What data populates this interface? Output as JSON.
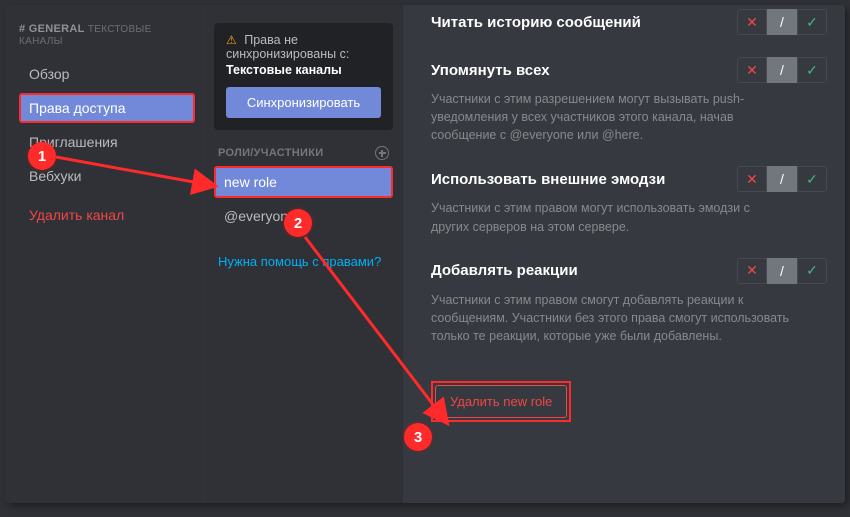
{
  "sidebar": {
    "channel_prefix": "# GENERAL",
    "channel_type": "ТЕКСТОВЫЕ КАНАЛЫ",
    "items": [
      "Обзор",
      "Права доступа",
      "Приглашения",
      "Вебхуки"
    ],
    "selected_index": 1,
    "delete": "Удалить канал"
  },
  "mid": {
    "sync_line1": "Права не синхронизированы с:",
    "sync_bold": "Текстовые каналы",
    "sync_btn": "Синхронизировать",
    "roles_header": "РОЛИ/УЧАСТНИКИ",
    "roles": [
      "new role",
      "@everyone"
    ],
    "selected_role_index": 0,
    "help": "Нужна помощь с правами?"
  },
  "perms": [
    {
      "title": "Читать историю сообщений",
      "desc": ""
    },
    {
      "title": "Упомянуть всех",
      "desc": "Участники с этим разрешением могут вызывать push-уведомления у всех участников этого канала, начав сообщение с @everyone или @here."
    },
    {
      "title": "Использовать внешние эмодзи",
      "desc": "Участники с этим правом могут использовать эмодзи с других серверов на этом сервере."
    },
    {
      "title": "Добавлять реакции",
      "desc": "Участники с этим правом смогут добавлять реакции к сообщениям. Участники без этого права смогут использовать только те реакции, которые уже были добавлены."
    }
  ],
  "delete_role_btn": "Удалить new role",
  "toggle": {
    "x": "✕",
    "slash": "/",
    "check": "✓"
  },
  "callouts": {
    "c1": "1",
    "c2": "2",
    "c3": "3"
  }
}
